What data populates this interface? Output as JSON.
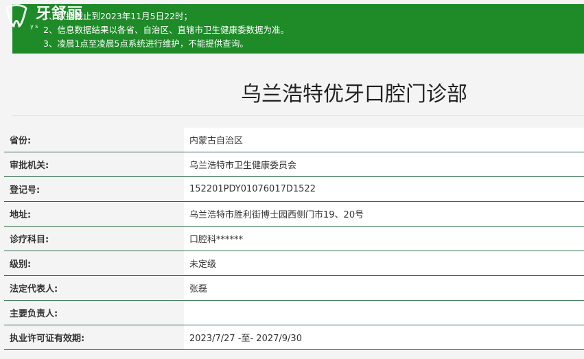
{
  "logo": {
    "name": "牙舒丽",
    "sub": "y  s"
  },
  "notice": {
    "lines": [
      "1、数据截止到2023年11月5日22时；",
      "2、信息数据结果以各省、自治区、直辖市卫生健康委数据为准。",
      "3、凌晨1点至凌晨5点系统进行维护，不能提供查询。"
    ]
  },
  "clinic": {
    "title": "乌兰浩特优牙口腔门诊部"
  },
  "details": [
    {
      "label": "省份:",
      "value": "内蒙古自治区"
    },
    {
      "label": "审批机关:",
      "value": "乌兰浩特市卫生健康委员会"
    },
    {
      "label": "登记号:",
      "value": "152201PDY01076017D1522"
    },
    {
      "label": "地址:",
      "value": "乌兰浩特市胜利街博士园西侧门市19、20号"
    },
    {
      "label": "诊疗科目:",
      "value": "口腔科******"
    },
    {
      "label": "级别:",
      "value": "未定级"
    },
    {
      "label": "法定代表人:",
      "value": "张磊"
    },
    {
      "label": "主要负责人:",
      "value": ""
    },
    {
      "label": "执业许可证有效期:",
      "value": "2023/7/27 -至- 2027/9/30"
    }
  ],
  "colors": {
    "banner": "#1e8a28",
    "row_border": "#2b6b47"
  }
}
